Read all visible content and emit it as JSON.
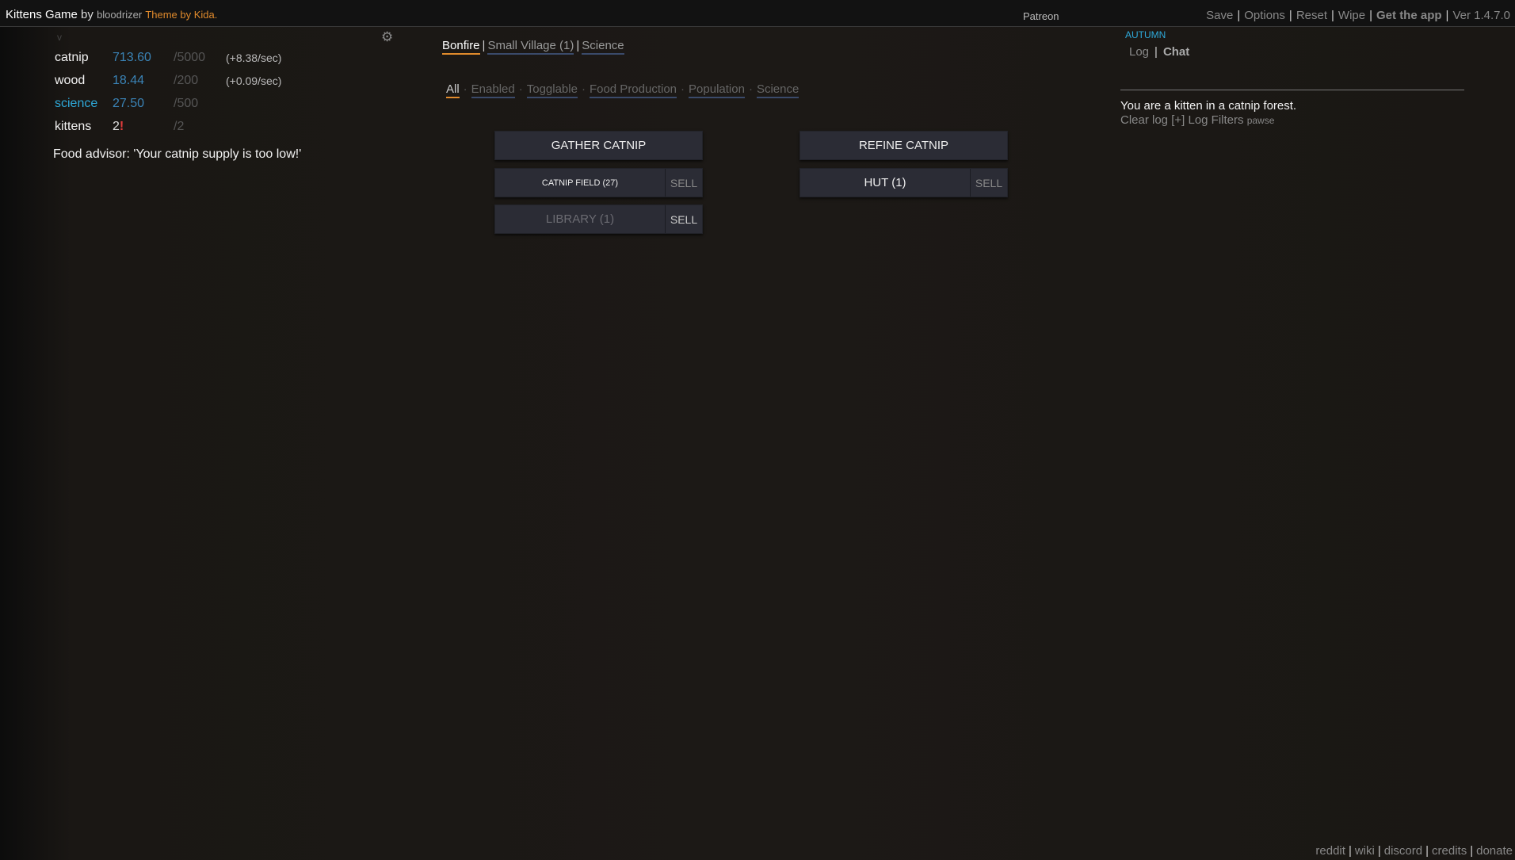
{
  "topbar": {
    "game_title": "Kittens Game",
    "by": "by",
    "author": "bloodrizer",
    "theme": "Theme by Kida.",
    "patreon": "Patreon",
    "menu": {
      "save": "Save",
      "options": "Options",
      "reset": "Reset",
      "wipe": "Wipe",
      "get_app": "Get the app",
      "version": "Ver 1.4.7.0"
    }
  },
  "left": {
    "toggle": "v",
    "settings_icon": "gear-icon",
    "resources": [
      {
        "name": "catnip",
        "value": "713.60",
        "max": "/5000",
        "rate": "(+8.38/sec)"
      },
      {
        "name": "wood",
        "value": "18.44",
        "max": "/200",
        "rate": "(+0.09/sec)"
      },
      {
        "name": "science",
        "value": "27.50",
        "max": "/500",
        "rate": ""
      },
      {
        "name": "kittens",
        "value": "2",
        "warn": "!",
        "max": "/2",
        "rate": ""
      }
    ],
    "advisor": "Food advisor: 'Your catnip supply is too low!'"
  },
  "tabs": [
    {
      "label": "Bonfire",
      "active": true
    },
    {
      "label": "Small Village (1)",
      "active": false
    },
    {
      "label": "Science",
      "active": false
    }
  ],
  "filters": [
    {
      "label": "All",
      "active": true
    },
    {
      "label": "Enabled"
    },
    {
      "label": "Togglable"
    },
    {
      "label": "Food Production"
    },
    {
      "label": "Population"
    },
    {
      "label": "Science"
    }
  ],
  "buttons": {
    "gather_catnip": "GATHER CATNIP",
    "refine_catnip": "REFINE CATNIP",
    "catnip_field": "CATNIP FIELD (27)",
    "catnip_field_sell": "SELL",
    "hut": "HUT (1)",
    "hut_sell": "SELL",
    "library": "LIBRARY (1)",
    "library_sell": "SELL"
  },
  "right": {
    "season": "AUTUMN",
    "log_tab": "Log",
    "chat_tab": "Chat",
    "log_message": "You are a kitten in a catnip forest.",
    "clear_log": "Clear log",
    "expand": "[+]",
    "log_filters": "Log Filters",
    "pawse": "pawse"
  },
  "footer": {
    "reddit": "reddit",
    "wiki": "wiki",
    "discord": "discord",
    "credits": "credits",
    "donate": "donate"
  },
  "colors": {
    "accent": "#e08a2c",
    "resource_value": "#3a83b6",
    "science": "#2ea8d8",
    "warning": "#e23c3c"
  }
}
